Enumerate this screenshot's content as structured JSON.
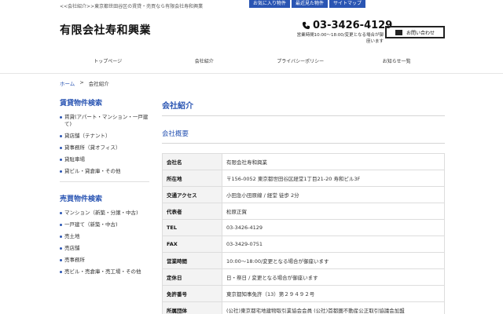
{
  "header": {
    "tagline": "<<会社紹介>>東京都世田谷区の賃貸・売買なら有限会社寿和興業",
    "top_links": [
      "お気に入り物件",
      "最近見た物件",
      "サイトマップ"
    ],
    "company_name": "有限会社寿和興業",
    "phone": "03-3426-4129",
    "hours": "営業時間10:00～18:00/変更となる場合が御座います",
    "contact_button": "お問い合わせ"
  },
  "nav": [
    "トップページ",
    "会社紹介",
    "プライバシーポリシー",
    "お知らせ一覧"
  ],
  "breadcrumb": {
    "home": "ホーム",
    "separator": ">",
    "current": "会社紹介"
  },
  "sidebar": {
    "rent_title": "賃貸物件検索",
    "rent_items": [
      "賃貸(アパート・マンション・一戸建て)",
      "貸店舗（テナント）",
      "貸事務所（貸オフィス）",
      "貸駐車場",
      "貸ビル・貸倉庫・その他"
    ],
    "sale_title": "売買物件検索",
    "sale_items": [
      "マンション（新築・分譲・中古)",
      "一戸建て（新築・中古)",
      "売土地",
      "売店舗",
      "売事務所",
      "売ビル・売倉庫・売工場・その他"
    ]
  },
  "main": {
    "title": "会社紹介",
    "subtitle": "会社概要",
    "rows": [
      {
        "k": "会社名",
        "v": "有限会社寿和興業"
      },
      {
        "k": "所在地",
        "v": "〒156-0052 東京都世田谷区経堂1丁目21-20 寿和ビル3F"
      },
      {
        "k": "交通アクセス",
        "v": "小田急小田原線 / 経堂 徒歩 2分"
      },
      {
        "k": "代表者",
        "v": "松原正賀"
      },
      {
        "k": "TEL",
        "v": "03-3426-4129"
      },
      {
        "k": "FAX",
        "v": "03-3429-0751"
      },
      {
        "k": "営業時間",
        "v": "10:00～18:00/変更となる場合が御座います"
      },
      {
        "k": "定休日",
        "v": "日・祭日 / 変更となる場合が御座います"
      },
      {
        "k": "免許番号",
        "v": "東京都知事免許（13）第２９４９２号"
      },
      {
        "k": "所属団体",
        "v": "(公社)東京都宅地建物取引業協会会員 (公社)首都圏不動産公正取引協議会加盟"
      }
    ]
  }
}
